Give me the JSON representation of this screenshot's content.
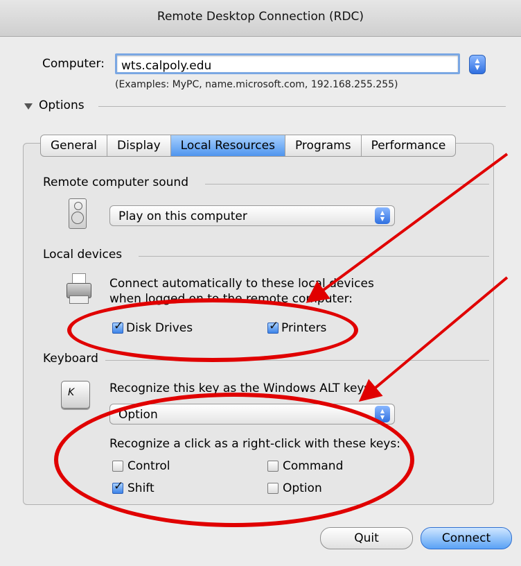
{
  "window": {
    "title": "Remote Desktop Connection (RDC)"
  },
  "computer": {
    "label": "Computer:",
    "value": "wts.calpoly.edu",
    "examples": "(Examples: MyPC, name.microsoft.com, 192.168.255.255)"
  },
  "options_label": "Options",
  "tabs": [
    {
      "label": "General",
      "active": false
    },
    {
      "label": "Display",
      "active": false
    },
    {
      "label": "Local Resources",
      "active": true
    },
    {
      "label": "Programs",
      "active": false
    },
    {
      "label": "Performance",
      "active": false
    }
  ],
  "sound": {
    "section": "Remote computer sound",
    "selected": "Play on this computer"
  },
  "devices": {
    "section": "Local devices",
    "line1": "Connect automatically to these local devices",
    "line2": "when logged on to the remote computer:",
    "disk_drives": {
      "label": "Disk Drives",
      "checked": true
    },
    "printers": {
      "label": "Printers",
      "checked": true
    }
  },
  "keyboard": {
    "section": "Keyboard",
    "alt_prompt": "Recognize this key as the Windows ALT key:",
    "alt_selected": "Option",
    "rightclick_prompt": "Recognize a click as a right-click with these keys:",
    "control": {
      "label": "Control",
      "checked": false
    },
    "command": {
      "label": "Command",
      "checked": false
    },
    "shift": {
      "label": "Shift",
      "checked": true
    },
    "option": {
      "label": "Option",
      "checked": false
    }
  },
  "buttons": {
    "quit": "Quit",
    "connect": "Connect"
  },
  "colors": {
    "annotation": "#e00000",
    "accent": "#4f95ee"
  }
}
